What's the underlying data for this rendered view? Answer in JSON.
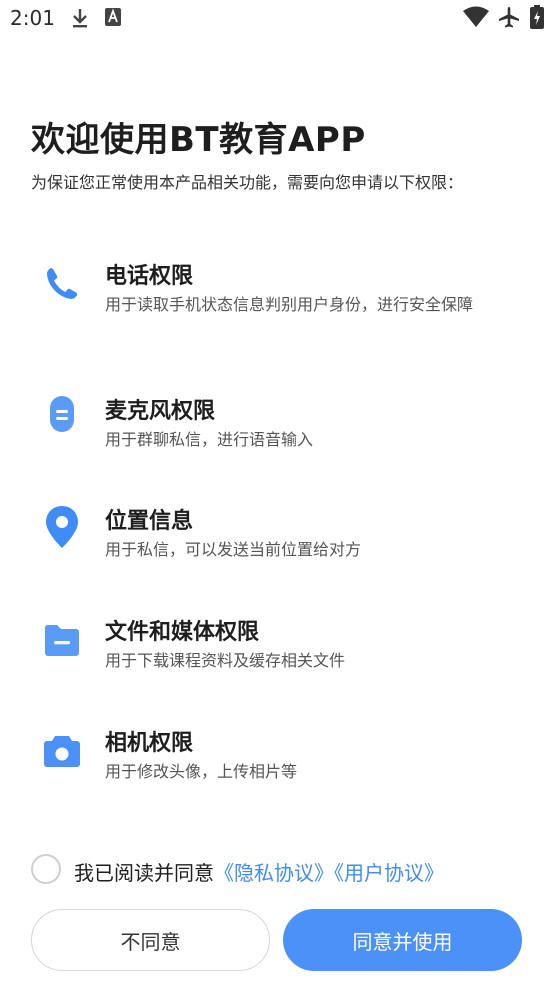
{
  "status_bar": {
    "time": "2:01",
    "left_icons": [
      "download-icon",
      "a11y-a-icon"
    ],
    "right_icons": [
      "wifi-icon",
      "airplane-icon",
      "battery-charging-icon"
    ]
  },
  "header": {
    "title": "欢迎使用BT教育APP",
    "subtitle": "为保证您正常使用本产品相关功能，需要向您申请以下权限："
  },
  "permissions": [
    {
      "icon": "phone-icon",
      "title": "电话权限",
      "desc": "用于读取手机状态信息判别用户身份，进行安全保障"
    },
    {
      "icon": "microphone-icon",
      "title": "麦克风权限",
      "desc": "用于群聊私信，进行语音输入"
    },
    {
      "icon": "location-pin-icon",
      "title": "位置信息",
      "desc": "用于私信，可以发送当前位置给对方"
    },
    {
      "icon": "folder-icon",
      "title": "文件和媒体权限",
      "desc": "用于下载课程资料及缓存相关文件"
    },
    {
      "icon": "camera-icon",
      "title": "相机权限",
      "desc": "用于修改头像，上传相片等"
    }
  ],
  "agreement": {
    "prefix": "我已阅读并同意",
    "privacy_link": "《隐私协议》",
    "user_link": "《用户协议》",
    "checked": false
  },
  "buttons": {
    "disagree": "不同意",
    "agree": "同意并使用"
  },
  "colors": {
    "accent": "#4b91f7",
    "icon_blue": "#3f8cf6",
    "link": "#3f8cf6"
  }
}
